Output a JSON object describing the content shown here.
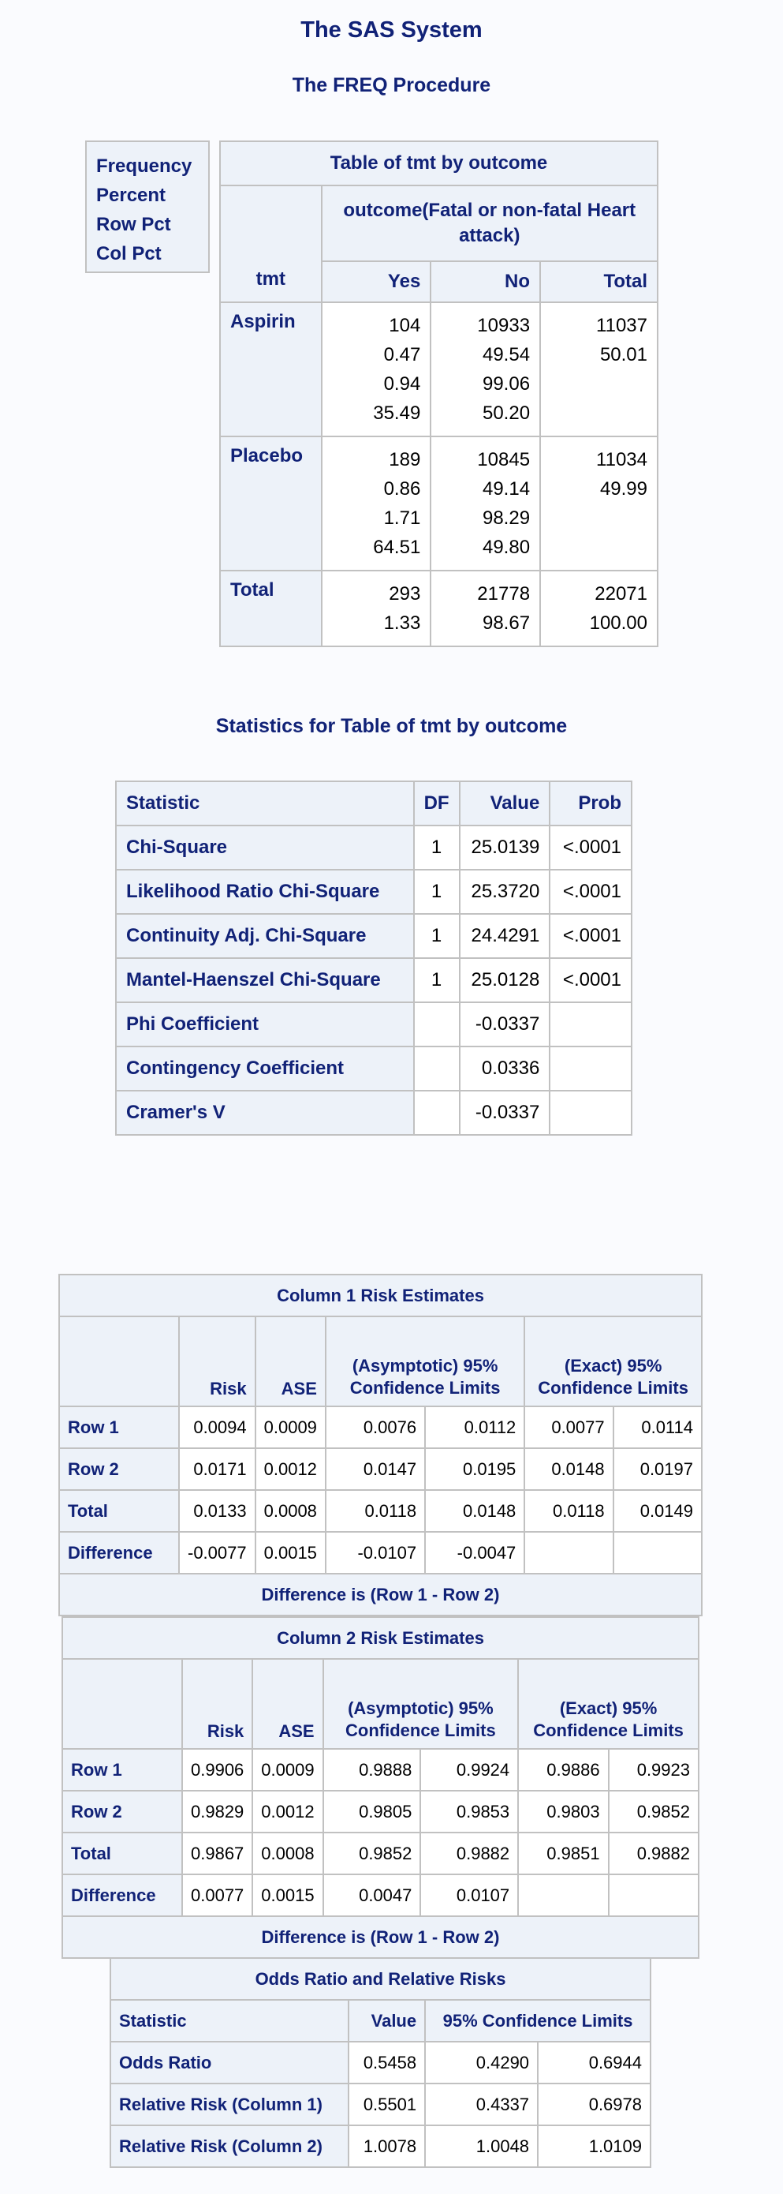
{
  "titles": {
    "system": "The SAS System",
    "procedure": "The FREQ Procedure",
    "statistics": "Statistics for Table of tmt by outcome"
  },
  "legend": [
    "Frequency",
    "Percent",
    "Row Pct",
    "Col Pct"
  ],
  "crosstab": {
    "title": "Table of tmt by outcome",
    "col_var": "outcome(Fatal or non-fatal Heart attack)",
    "row_var": "tmt",
    "columns": [
      "Yes",
      "No",
      "Total"
    ],
    "rows": [
      {
        "label": "Aspirin",
        "yes": [
          "104",
          "0.47",
          "0.94",
          "35.49"
        ],
        "no": [
          "10933",
          "49.54",
          "99.06",
          "50.20"
        ],
        "total": [
          "11037",
          "50.01"
        ]
      },
      {
        "label": "Placebo",
        "yes": [
          "189",
          "0.86",
          "1.71",
          "64.51"
        ],
        "no": [
          "10845",
          "49.14",
          "98.29",
          "49.80"
        ],
        "total": [
          "11034",
          "49.99"
        ]
      },
      {
        "label": "Total",
        "yes": [
          "293",
          "1.33"
        ],
        "no": [
          "21778",
          "98.67"
        ],
        "total": [
          "22071",
          "100.00"
        ]
      }
    ]
  },
  "stats": {
    "headers": [
      "Statistic",
      "DF",
      "Value",
      "Prob"
    ],
    "rows": [
      [
        "Chi-Square",
        "1",
        "25.0139",
        "<.0001"
      ],
      [
        "Likelihood Ratio Chi-Square",
        "1",
        "25.3720",
        "<.0001"
      ],
      [
        "Continuity Adj. Chi-Square",
        "1",
        "24.4291",
        "<.0001"
      ],
      [
        "Mantel-Haenszel Chi-Square",
        "1",
        "25.0128",
        "<.0001"
      ],
      [
        "Phi Coefficient",
        "",
        "-0.0337",
        ""
      ],
      [
        "Contingency Coefficient",
        "",
        "0.0336",
        ""
      ],
      [
        "Cramer's V",
        "",
        "-0.0337",
        ""
      ]
    ]
  },
  "risk_tables": [
    {
      "title": "Column 1 Risk Estimates",
      "headers": [
        "",
        "Risk",
        "ASE",
        "(Asymptotic) 95% Confidence Limits",
        "(Exact) 95% Confidence Limits"
      ],
      "rows": [
        [
          "Row 1",
          "0.0094",
          "0.0009",
          "0.0076",
          "0.0112",
          "0.0077",
          "0.0114"
        ],
        [
          "Row 2",
          "0.0171",
          "0.0012",
          "0.0147",
          "0.0195",
          "0.0148",
          "0.0197"
        ],
        [
          "Total",
          "0.0133",
          "0.0008",
          "0.0118",
          "0.0148",
          "0.0118",
          "0.0149"
        ],
        [
          "Difference",
          "-0.0077",
          "0.0015",
          "-0.0107",
          "-0.0047",
          "",
          ""
        ]
      ],
      "footer": "Difference is (Row 1 - Row 2)"
    },
    {
      "title": "Column 2 Risk Estimates",
      "headers": [
        "",
        "Risk",
        "ASE",
        "(Asymptotic) 95% Confidence Limits",
        "(Exact) 95% Confidence Limits"
      ],
      "rows": [
        [
          "Row 1",
          "0.9906",
          "0.0009",
          "0.9888",
          "0.9924",
          "0.9886",
          "0.9923"
        ],
        [
          "Row 2",
          "0.9829",
          "0.0012",
          "0.9805",
          "0.9853",
          "0.9803",
          "0.9852"
        ],
        [
          "Total",
          "0.9867",
          "0.0008",
          "0.9852",
          "0.9882",
          "0.9851",
          "0.9882"
        ],
        [
          "Difference",
          "0.0077",
          "0.0015",
          "0.0047",
          "0.0107",
          "",
          ""
        ]
      ],
      "footer": "Difference is (Row 1 - Row 2)"
    }
  ],
  "odds": {
    "title": "Odds Ratio and Relative Risks",
    "headers": [
      "Statistic",
      "Value",
      "95% Confidence Limits"
    ],
    "rows": [
      [
        "Odds Ratio",
        "0.5458",
        "0.4290",
        "0.6944"
      ],
      [
        "Relative Risk (Column 1)",
        "0.5501",
        "0.4337",
        "0.6978"
      ],
      [
        "Relative Risk (Column 2)",
        "1.0078",
        "1.0048",
        "1.0109"
      ]
    ]
  }
}
